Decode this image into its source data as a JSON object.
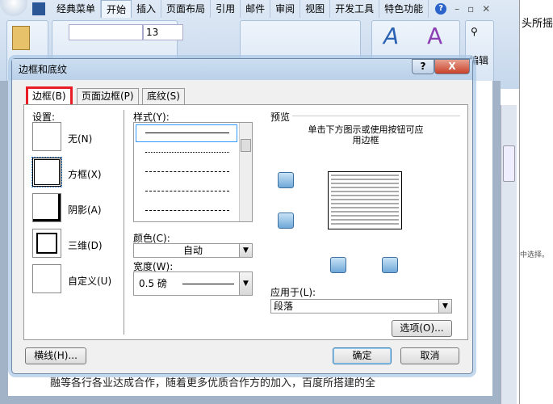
{
  "ribbon": {
    "tabs": [
      "经典菜单",
      "开始",
      "插入",
      "页面布局",
      "引用",
      "邮件",
      "审阅",
      "视图",
      "开发工具",
      "特色功能"
    ],
    "active_tab": "开始",
    "font_size": "13",
    "edit_label": "编辑",
    "help_icon": "help-icon"
  },
  "doc": {
    "text": "融等各行各业达成合作，随着更多优质合作方的加入，百度所搭建的全",
    "right_text": "头所摇",
    "side_text": "中选择。"
  },
  "dialog": {
    "title": "边框和底纹",
    "help": "?",
    "close": "X",
    "tabs": [
      "边框(B)",
      "页面边框(P)",
      "底纹(S)"
    ],
    "settings_label": "设置:",
    "settings": [
      "无(N)",
      "方框(X)",
      "阴影(A)",
      "三维(D)",
      "自定义(U)"
    ],
    "selected_setting": "方框(X)",
    "style_label": "样式(Y):",
    "color_label": "颜色(C):",
    "color_value": "自动",
    "width_label": "宽度(W):",
    "width_value": "0.5 磅",
    "preview_label": "预览",
    "preview_hint": "单击下方图示或使用按钮可应用边框",
    "apply_label": "应用于(L):",
    "apply_value": "段落",
    "options_btn": "选项(O)...",
    "hline_btn": "横线(H)...",
    "ok": "确定",
    "cancel": "取消"
  }
}
